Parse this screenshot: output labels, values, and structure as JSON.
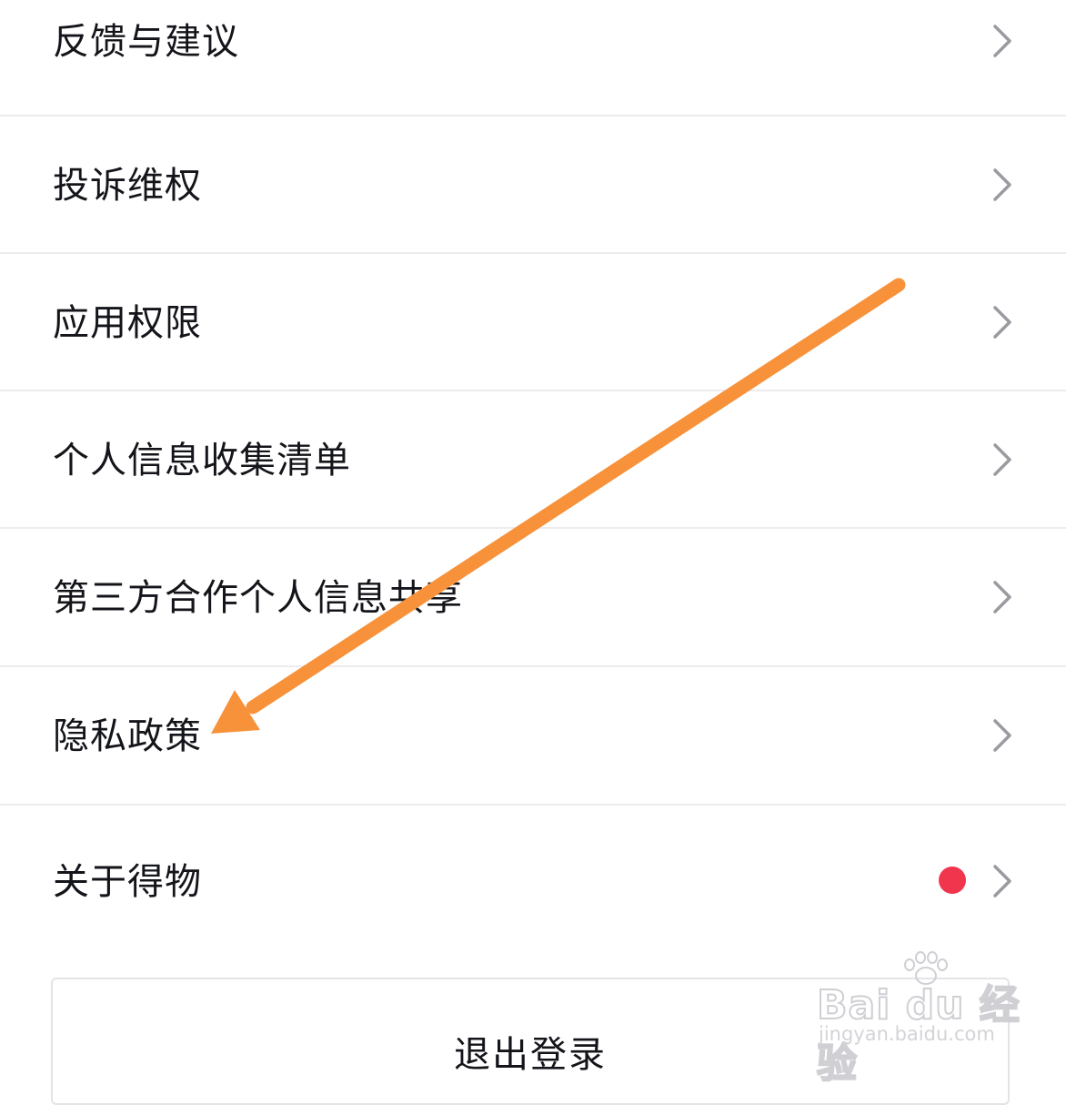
{
  "menu": {
    "items": [
      {
        "label": "反馈与建议"
      },
      {
        "label": "投诉维权"
      },
      {
        "label": "应用权限"
      },
      {
        "label": "个人信息收集清单"
      },
      {
        "label": "第三方合作个人信息共享"
      },
      {
        "label": "隐私政策"
      },
      {
        "label": "关于得物",
        "has_badge": true
      }
    ]
  },
  "logout": {
    "label": "退出登录"
  },
  "colors": {
    "badge": "#f0354d",
    "arrow": "#f7923b",
    "chevron": "#9a9aa0",
    "divider": "#ececef"
  },
  "icons": {
    "chevron": "chevron-right-icon",
    "badge": "red-dot-badge",
    "annotation": "orange-arrow"
  },
  "watermark": {
    "logo": "Bai du 经验",
    "url": "jingyan.baidu.com"
  }
}
